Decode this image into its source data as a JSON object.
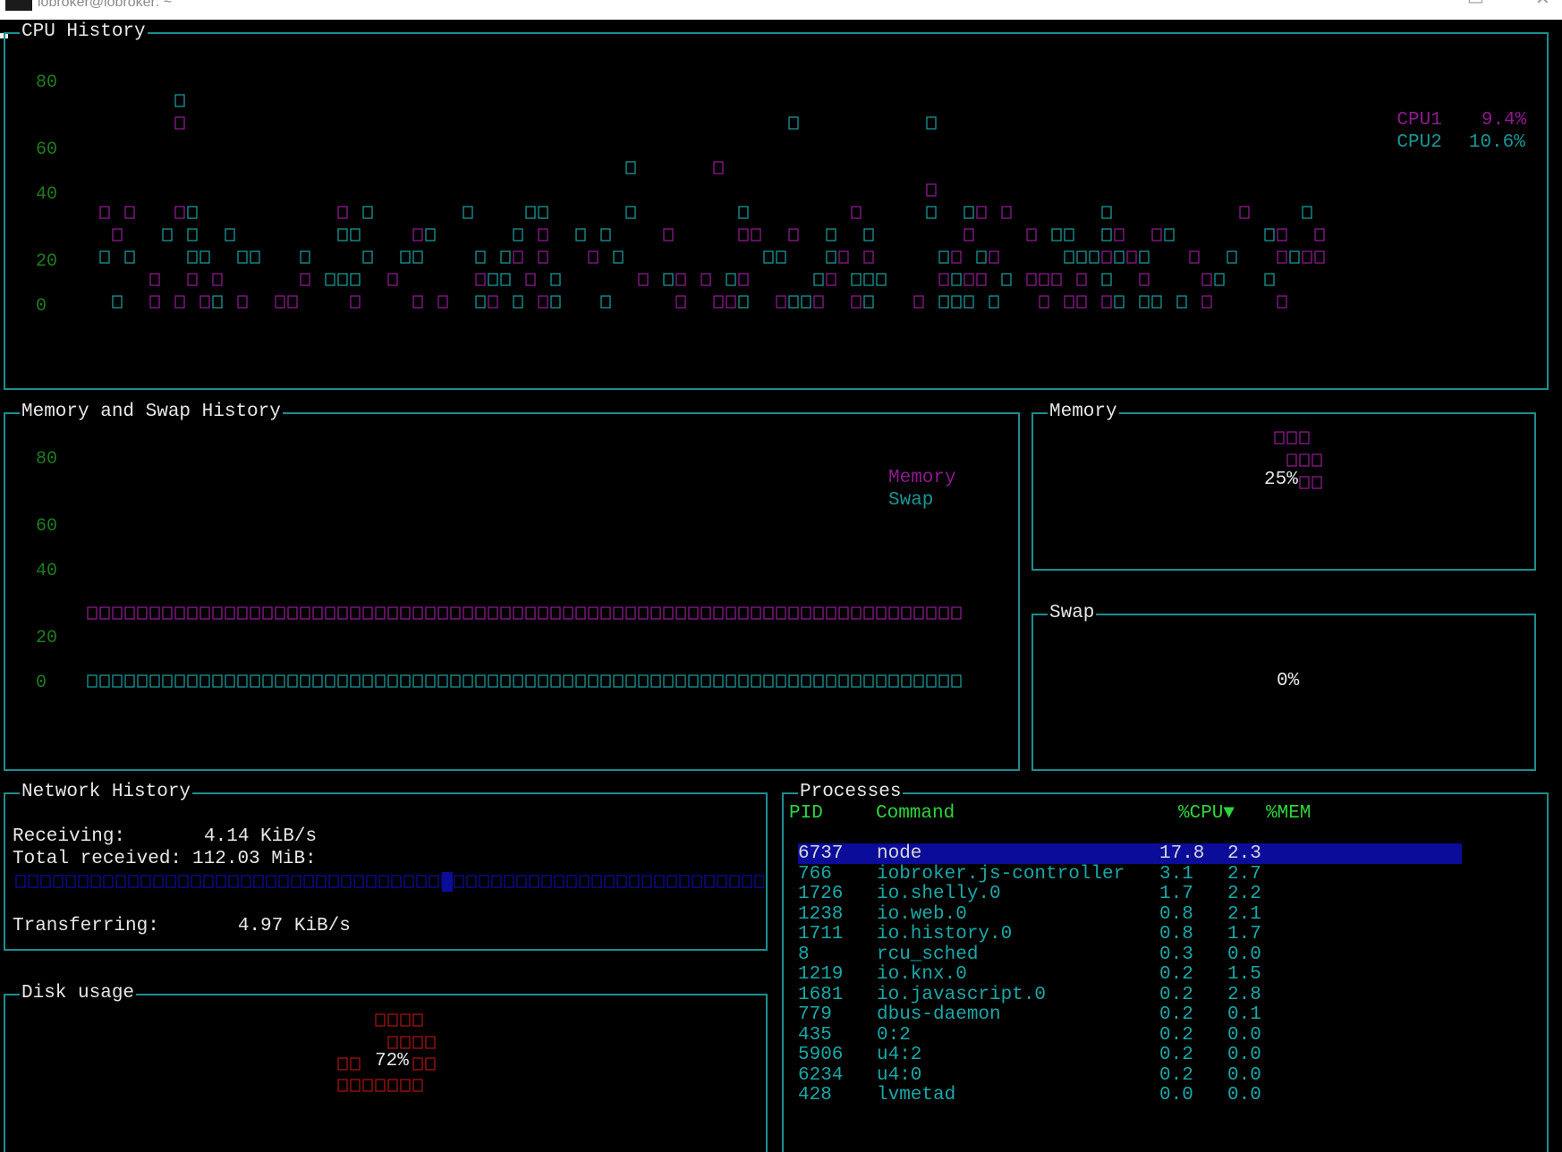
{
  "window": {
    "title": "iobroker@iobroker: ~",
    "minimize_icon": "minimize-icon",
    "close_icon": "close-icon"
  },
  "colors": {
    "border": "#1c8e8e",
    "cpu1": "#8e1a8e",
    "cpu2": "#1a9696",
    "memory": "#8e1a8e",
    "swap": "#1a9696",
    "disk": "#a31212",
    "axis": "#1e7d1e",
    "header": "#2bd63b",
    "selected_bg": "#0b0c9a"
  },
  "cpu_history": {
    "title": "CPU History",
    "y_ticks": [
      "80",
      "60",
      "40",
      "20",
      "0"
    ],
    "legend": [
      {
        "name": "CPU1",
        "value": "9.4%"
      },
      {
        "name": "CPU2",
        "value": "10.6%"
      }
    ]
  },
  "memory_history": {
    "title": "Memory and Swap History",
    "y_ticks": [
      "80",
      "60",
      "40",
      "20",
      "0"
    ],
    "legend": [
      {
        "name": "Memory"
      },
      {
        "name": "Swap"
      }
    ]
  },
  "memory_gauge": {
    "title": "Memory",
    "percent_label": "25%",
    "value": 25
  },
  "swap_gauge": {
    "title": "Swap",
    "percent_label": "0%",
    "value": 0
  },
  "disk_gauge": {
    "title": "Disk usage",
    "percent_label": "72%",
    "value": 72
  },
  "network": {
    "title": "Network History",
    "receiving_label": "Receiving:",
    "receiving_value": "4.14 KiB/s",
    "total_received_label": "Total received:",
    "total_received_value": "112.03 MiB:",
    "transferring_label": "Transferring:",
    "transferring_value": "4.97 KiB/s",
    "sparkline_position": 0.58
  },
  "processes": {
    "title": "Processes",
    "columns": [
      "PID",
      "Command",
      "%CPU▼",
      "%MEM"
    ],
    "rows": [
      {
        "pid": "6737",
        "command": "node",
        "cpu": "17.8",
        "mem": "2.3"
      },
      {
        "pid": "766",
        "command": "iobroker.js-controller",
        "cpu": "3.1",
        "mem": "2.7"
      },
      {
        "pid": "1726",
        "command": "io.shelly.0",
        "cpu": "1.7",
        "mem": "2.2"
      },
      {
        "pid": "1238",
        "command": "io.web.0",
        "cpu": "0.8",
        "mem": "2.1"
      },
      {
        "pid": "1711",
        "command": "io.history.0",
        "cpu": "0.8",
        "mem": "1.7"
      },
      {
        "pid": "8",
        "command": "rcu_sched",
        "cpu": "0.3",
        "mem": "0.0"
      },
      {
        "pid": "1219",
        "command": "io.knx.0",
        "cpu": "0.2",
        "mem": "1.5"
      },
      {
        "pid": "1681",
        "command": "io.javascript.0",
        "cpu": "0.2",
        "mem": "2.8"
      },
      {
        "pid": "779",
        "command": "dbus-daemon",
        "cpu": "0.2",
        "mem": "0.1"
      },
      {
        "pid": "435",
        "command": "0:2",
        "cpu": "0.2",
        "mem": "0.0"
      },
      {
        "pid": "5906",
        "command": "u4:2",
        "cpu": "0.2",
        "mem": "0.0"
      },
      {
        "pid": "6234",
        "command": "u4:0",
        "cpu": "0.2",
        "mem": "0.0"
      },
      {
        "pid": "428",
        "command": "lvmetad",
        "cpu": "0.0",
        "mem": "0.0"
      }
    ]
  }
}
